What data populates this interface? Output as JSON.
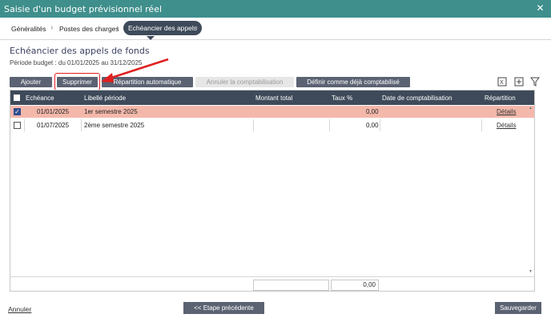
{
  "window": {
    "title": "Saisie d'un budget prévisionnel réel",
    "close_glyph": "✕"
  },
  "wizard": {
    "steps": [
      "Généralités",
      "Postes des charges",
      "Echéancier des appels"
    ],
    "chevron": "›"
  },
  "page": {
    "heading": "Echéancier des appels de fonds",
    "periode": "Période budget : du 01/01/2025 au 31/12/2025"
  },
  "toolbar": {
    "ajouter": "Ajouter",
    "supprimer": "Supprimer",
    "repartition": "Répartition automatique",
    "annuler_compta": "Annuler la comptabilisation",
    "definir": "Définir comme déjà comptabilisé",
    "icons": [
      "export-excel-icon",
      "add-column-icon",
      "filter-icon"
    ]
  },
  "table": {
    "headers": [
      "Echéance",
      "Libellé période",
      "Montant total",
      "Taux %",
      "Date de comptabilisation",
      "Répartition"
    ],
    "rows": [
      {
        "checked": true,
        "echeance": "01/01/2025",
        "libelle": "1er semestre 2025",
        "montant": "",
        "taux": "0,00",
        "date_compta": "",
        "repartition": "Détails"
      },
      {
        "checked": false,
        "echeance": "01/07/2025",
        "libelle": "2ème semestre 2025",
        "montant": "",
        "taux": "0,00",
        "date_compta": "",
        "repartition": "Détails"
      }
    ],
    "total_montant": "",
    "total_taux": "0,00"
  },
  "footer": {
    "annuler": "Annuler",
    "prev": "<< Etape précédente",
    "save": "Sauvegarder"
  },
  "colors": {
    "titlebar": "#3f8f8c",
    "header": "#3e4a5a",
    "selected_row": "#f4b8ab",
    "button": "#5b6272",
    "highlight": "#e02020"
  }
}
